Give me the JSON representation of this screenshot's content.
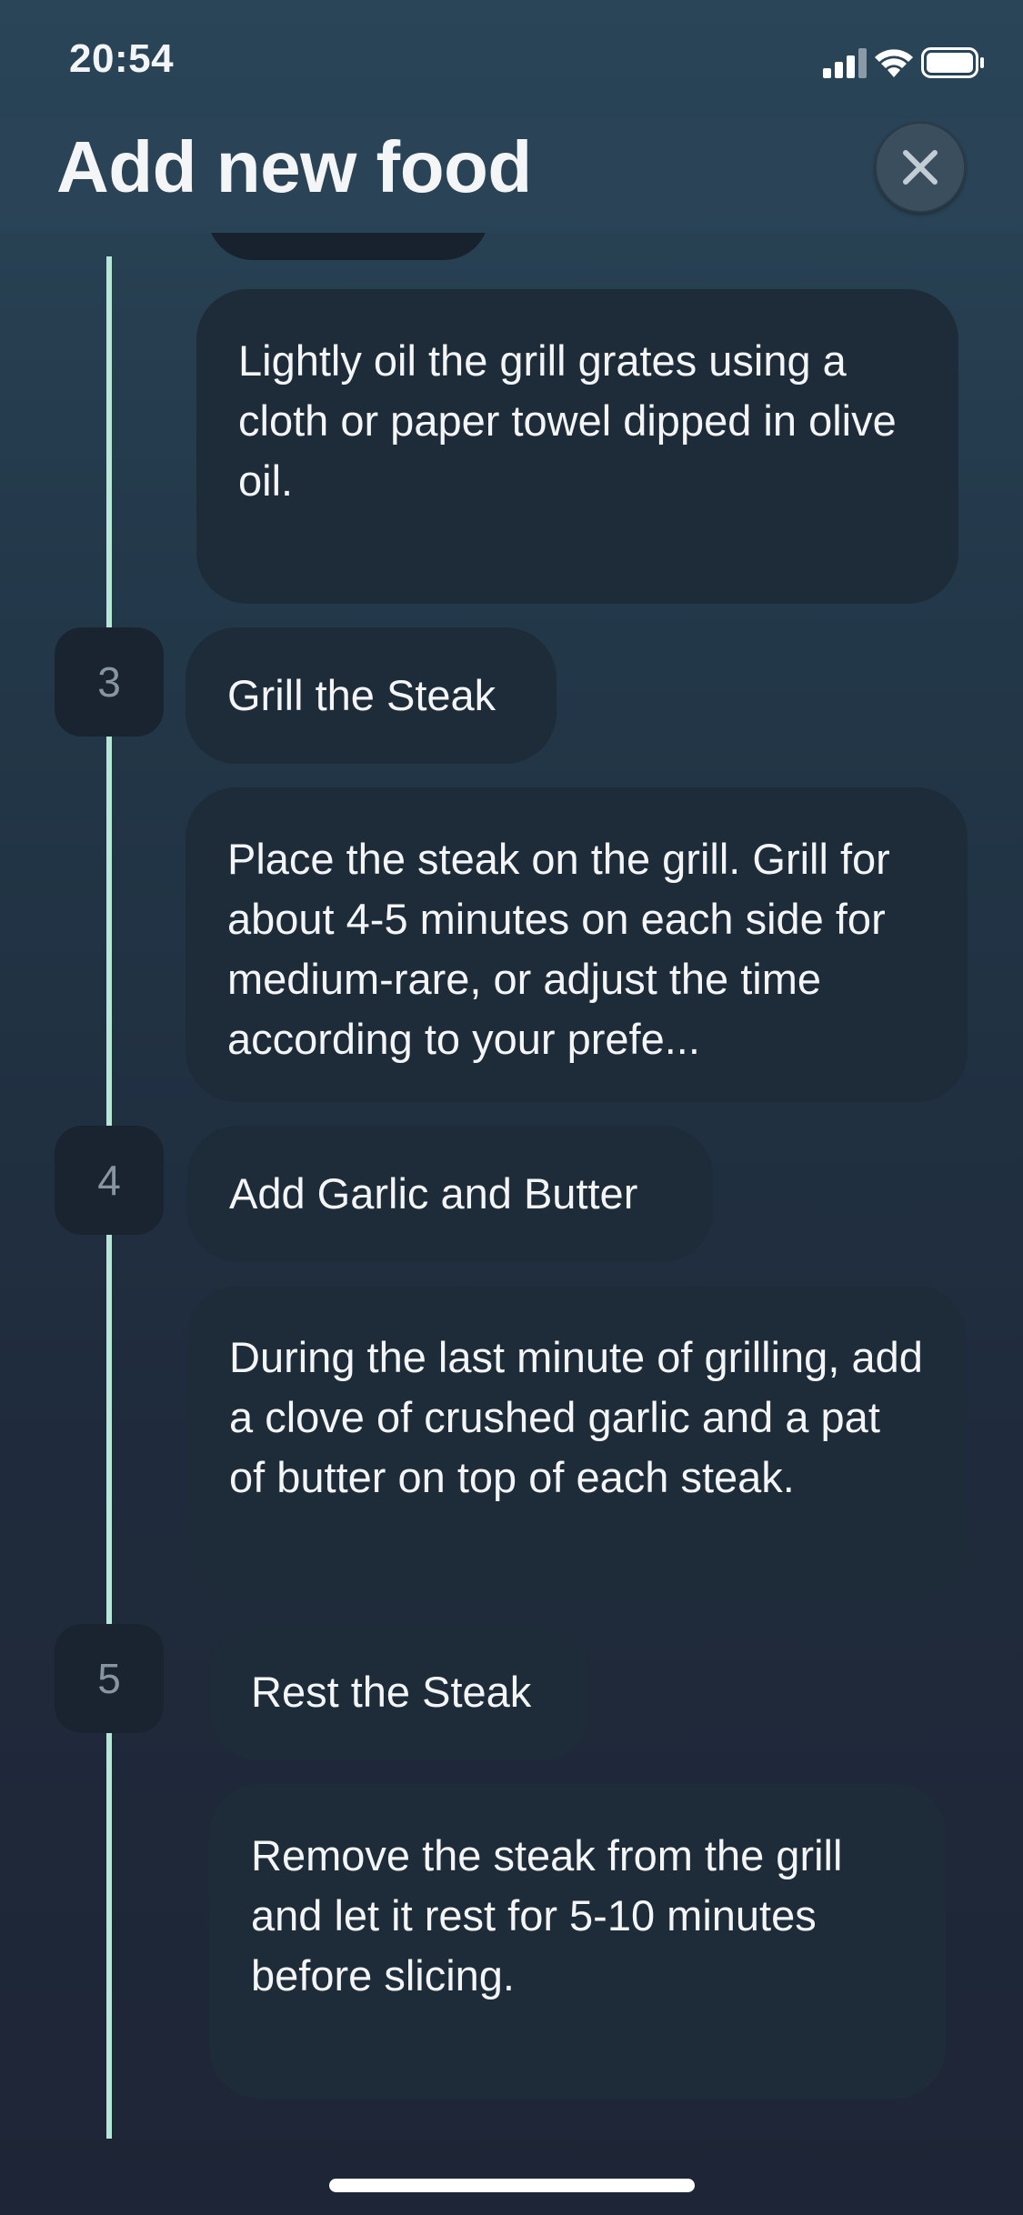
{
  "status_bar": {
    "time": "20:54",
    "icons": [
      "signal-icon",
      "wifi-icon",
      "battery-icon"
    ]
  },
  "header": {
    "title": "Add new food",
    "close_icon": "close-icon"
  },
  "colors": {
    "background_top": "#2a4558",
    "background_bottom": "#1e2536",
    "bubble": "#1e2b39",
    "step_badge": "#1a2430",
    "timeline": "#b6e6d6"
  },
  "steps": [
    {
      "description": "Lightly oil the grill grates using a cloth or paper towel dipped in olive oil."
    },
    {
      "number": "3",
      "title": "Grill the Steak",
      "description": "Place the steak on the grill. Grill for about 4-5 minutes on each side for medium-rare, or adjust the time according to your prefe..."
    },
    {
      "number": "4",
      "title": "Add Garlic and Butter",
      "description": "During the last minute of grilling, add a clove of crushed garlic and a pat of butter on top of each steak."
    },
    {
      "number": "5",
      "title": "Rest the Steak",
      "description": "Remove the steak from the grill and let it rest for 5-10 minutes before slicing."
    }
  ]
}
